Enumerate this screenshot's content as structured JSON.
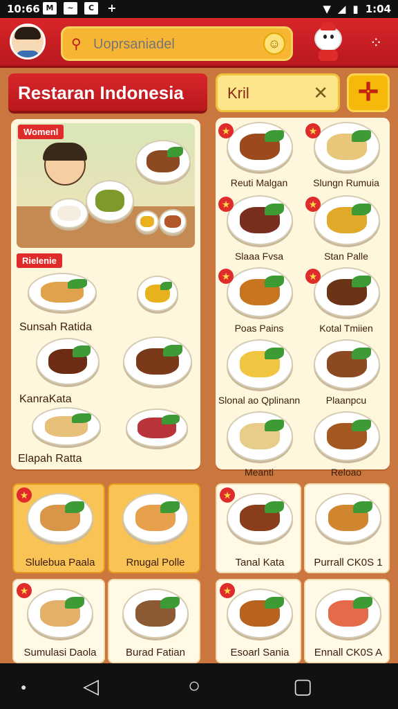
{
  "status_bar": {
    "time": "10:66",
    "right_time": "1:04",
    "notif_icons": [
      "M",
      "~",
      "C",
      "+"
    ]
  },
  "header": {
    "search_placeholder": "Uoprsaniadel"
  },
  "title": "Restaran Indonesia",
  "filter": {
    "text": "Kril"
  },
  "left_panel": {
    "badge_top": "Womenl",
    "badge_mid": "Rielenie",
    "items": [
      {
        "label": "Sunsah Ratida"
      },
      {
        "label": "KanraKata"
      },
      {
        "label": "Elapah Ratta"
      }
    ]
  },
  "right_panel": {
    "items": [
      {
        "label": "Reuti Malgan",
        "color": "#9c4a1c"
      },
      {
        "label": "Slungn Rumuia",
        "color": "#e8c77a"
      },
      {
        "label": "Slaaa Fvsa",
        "color": "#7a2e1e"
      },
      {
        "label": "Stan Palle",
        "color": "#e0a92a"
      },
      {
        "label": "Poas Pains",
        "color": "#c9741f"
      },
      {
        "label": "Kotal Tmiien",
        "color": "#6b3416"
      },
      {
        "label": "Slonal ao Qplinann",
        "color": "#f0c542"
      },
      {
        "label": "Plaanpcu",
        "color": "#8b4a22"
      },
      {
        "label": "Meanti",
        "color": "#e8cd8a"
      },
      {
        "label": "Reloao",
        "color": "#a4581f"
      }
    ]
  },
  "bottom_tiles": [
    {
      "label": "Slulebua Paala",
      "color": "#d99548",
      "selected": true
    },
    {
      "label": "Rnugal Polle",
      "color": "#e7a04c",
      "selected": true
    },
    {
      "label": "Tanal Kata",
      "color": "#8a3d1a"
    },
    {
      "label": "Purrall CK0S 1",
      "color": "#d0862c"
    },
    {
      "label": "Sumulasi Daola",
      "color": "#e3b06a"
    },
    {
      "label": "Burad Fatian",
      "color": "#8c5a34"
    },
    {
      "label": "Esoarl Sania",
      "color": "#b8621e"
    },
    {
      "label": "Ennall CK0S A",
      "color": "#e46a4a"
    }
  ]
}
